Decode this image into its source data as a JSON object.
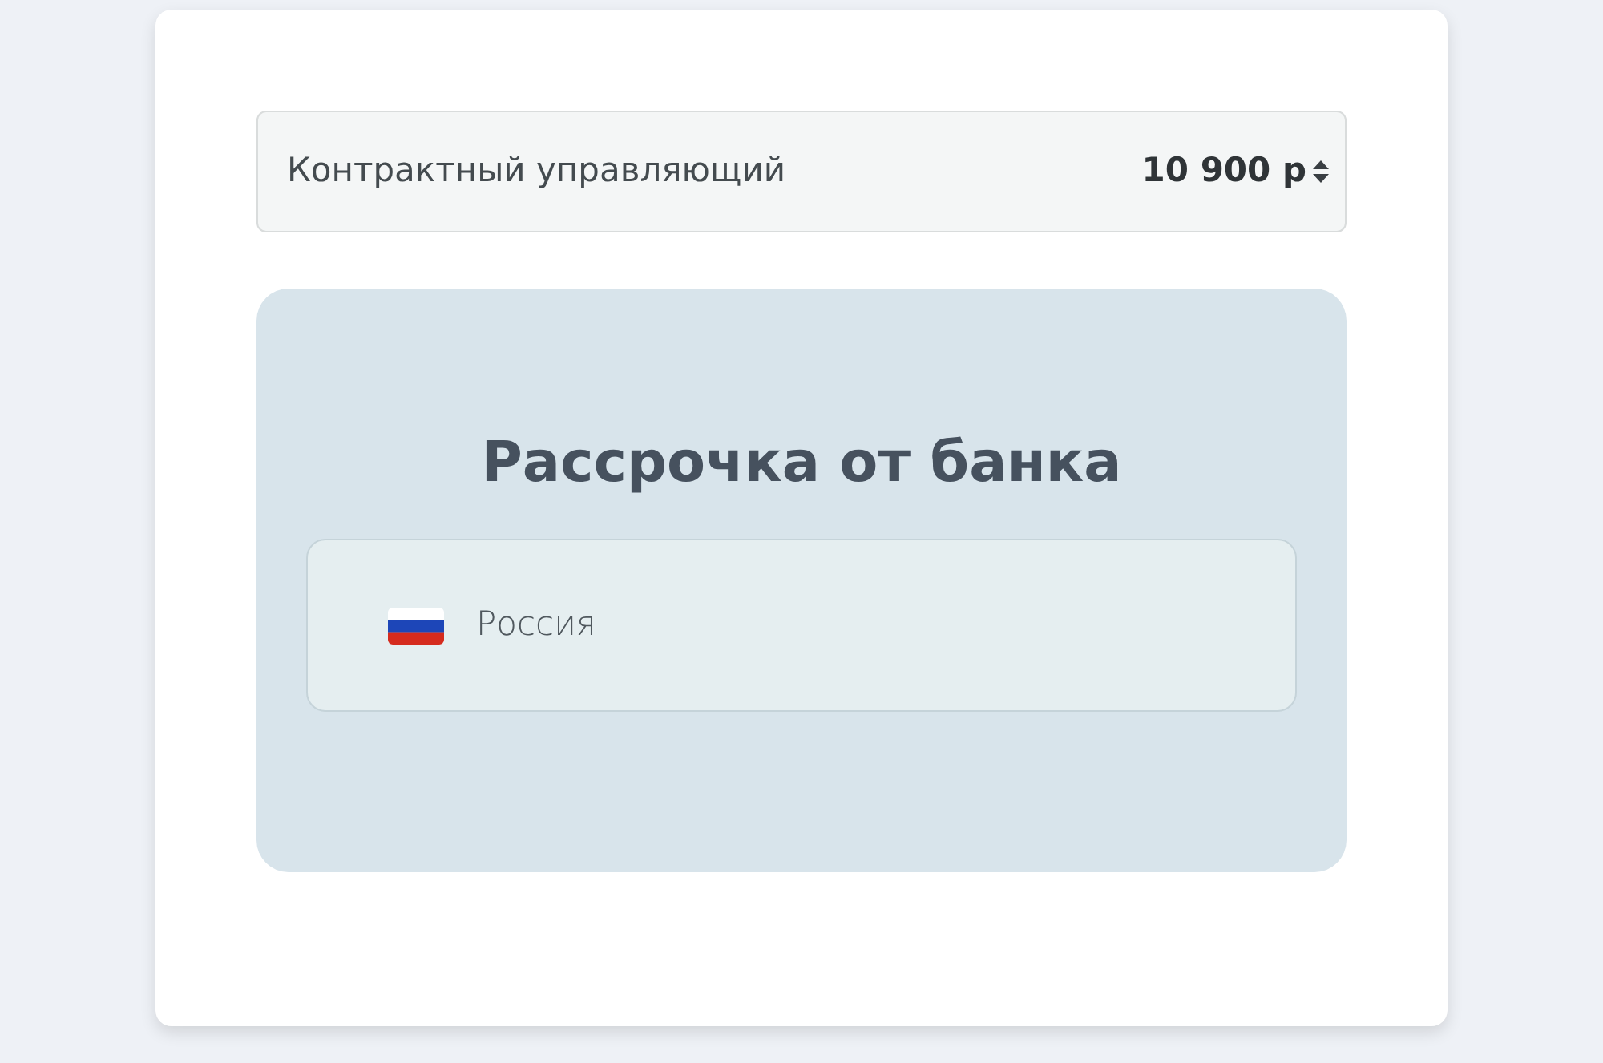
{
  "tariff_select": {
    "label": "Контрактный управляющий",
    "price": "10 900 р"
  },
  "installment_panel": {
    "title": "Рассрочка от банка",
    "countries": [
      {
        "name": "Россия"
      }
    ]
  }
}
